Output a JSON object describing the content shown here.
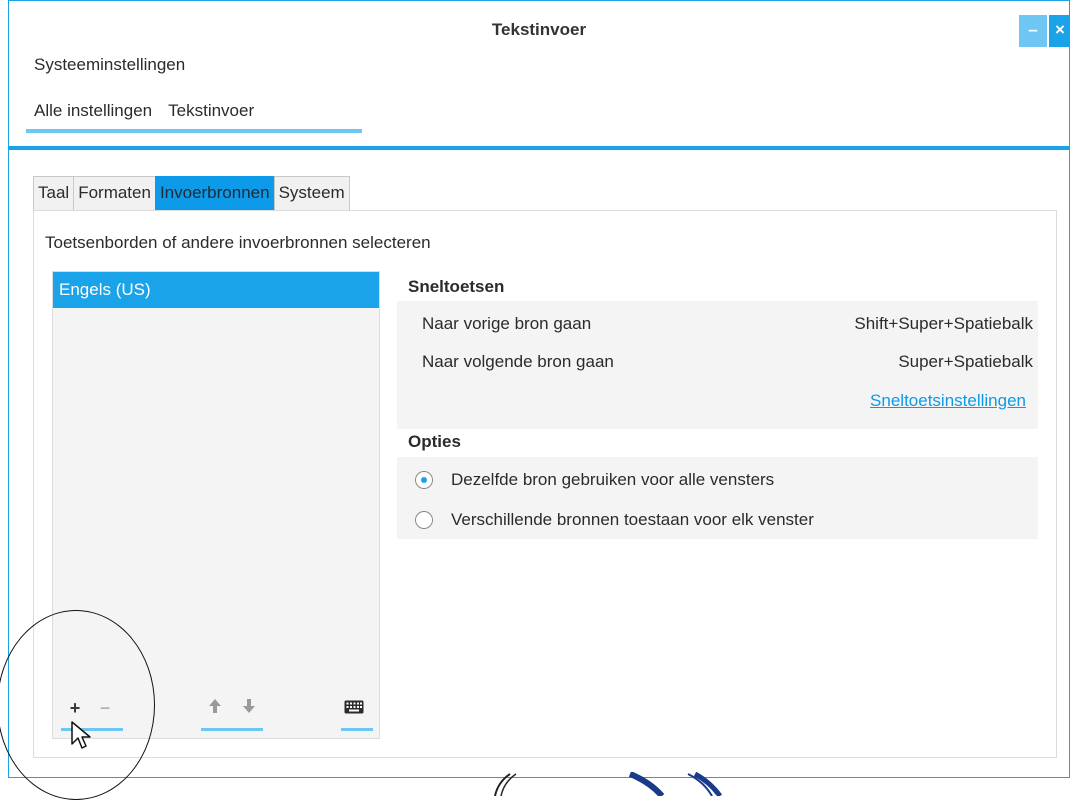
{
  "window": {
    "title": "Tekstinvoer",
    "minimize": "–",
    "close": "×"
  },
  "app_title": "Systeeminstellingen",
  "breadcrumb": [
    "Alle instellingen",
    "Tekstinvoer"
  ],
  "tabs": [
    {
      "label": "Taal",
      "active": false
    },
    {
      "label": "Formaten",
      "active": false
    },
    {
      "label": "Invoerbronnen",
      "active": true
    },
    {
      "label": "Systeem",
      "active": false
    }
  ],
  "panel": {
    "heading": "Toetsenborden of andere invoerbronnen selecteren",
    "sources": [
      "Engels (US)"
    ],
    "toolbar": {
      "add": "+",
      "remove": "−",
      "up": "🠅",
      "down": "🠇",
      "keyboard": "⌨"
    }
  },
  "shortcuts": {
    "title": "Sneltoetsen",
    "rows": [
      {
        "label": "Naar vorige bron gaan",
        "keys": "Shift+Super+Spatiebalk"
      },
      {
        "label": "Naar volgende bron gaan",
        "keys": "Super+Spatiebalk"
      }
    ],
    "settings_link": "Sneltoetsinstellingen"
  },
  "options": {
    "title": "Opties",
    "radios": [
      {
        "label": "Dezelfde bron gebruiken voor alle vensters",
        "checked": true
      },
      {
        "label": "Verschillende bronnen toestaan voor elk venster",
        "checked": false
      }
    ]
  },
  "colors": {
    "accent": "#1aa3e8",
    "accent_light": "#6ec6f2",
    "panel_bg": "#f4f4f4"
  }
}
